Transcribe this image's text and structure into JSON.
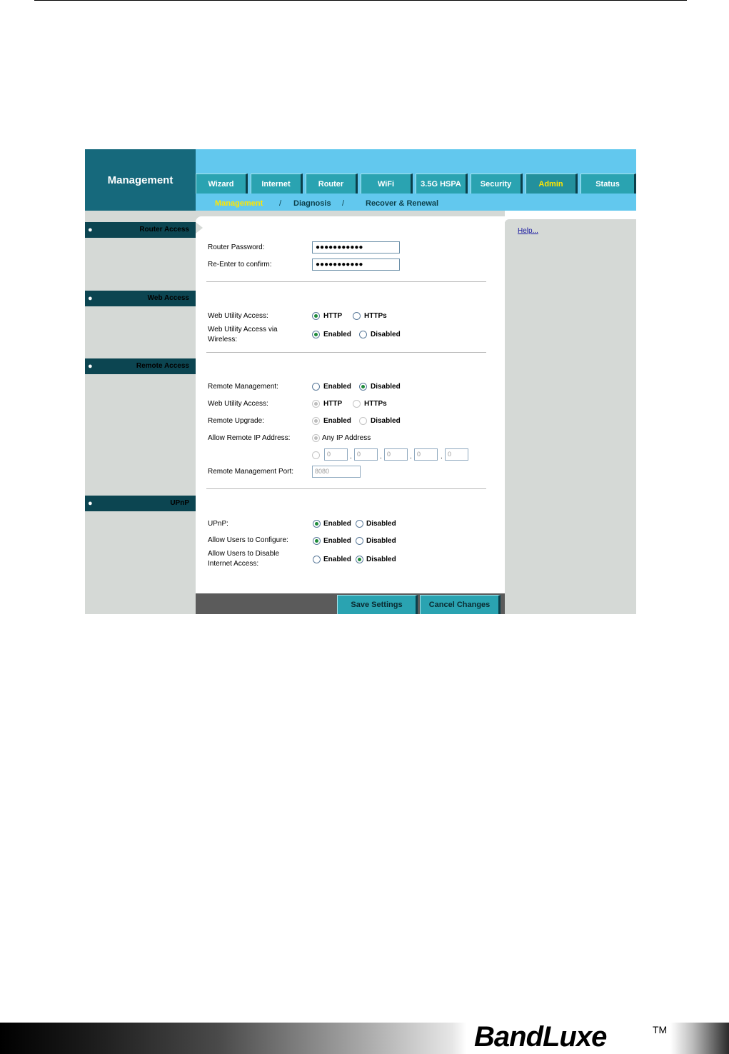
{
  "app": {
    "title": "Management"
  },
  "tabs": [
    {
      "label": "Wizard"
    },
    {
      "label": "Internet"
    },
    {
      "label": "Router"
    },
    {
      "label": "WiFi"
    },
    {
      "label": "3.5G HSPA"
    },
    {
      "label": "Security"
    },
    {
      "label": "Admin"
    },
    {
      "label": "Status"
    }
  ],
  "subnav": {
    "items": [
      "Management",
      "Diagnosis",
      "Recover & Renewal"
    ],
    "sep1": "/",
    "sep2": "/"
  },
  "sections": {
    "router_access": "Router Access",
    "web_access": "Web Access",
    "remote_access": "Remote Access",
    "upnp": "UPnP"
  },
  "help": {
    "link": "Help..."
  },
  "router_access": {
    "password_label": "Router Password:",
    "password_value": "●●●●●●●●●●●",
    "confirm_label": "Re-Enter to confirm:",
    "confirm_value": "●●●●●●●●●●●"
  },
  "web_access": {
    "access_label": "Web Utility Access:",
    "http": "HTTP",
    "https": "HTTPs",
    "wireless_label_1": "Web Utility Access via",
    "wireless_label_2": "Wireless:",
    "enabled": "Enabled",
    "disabled": "Disabled"
  },
  "remote_access": {
    "mgmt_label": "Remote Management:",
    "access_label": "Web Utility Access:",
    "upgrade_label": "Remote Upgrade:",
    "allow_ip_label": "Allow Remote IP Address:",
    "any_ip": "Any IP Address",
    "ip": [
      "0",
      "0",
      "0",
      "0",
      "0"
    ],
    "port_label": "Remote Management Port:",
    "port_value": "8080",
    "enabled": "Enabled",
    "disabled": "Disabled",
    "http": "HTTP",
    "https": "HTTPs"
  },
  "upnp": {
    "upnp_label": "UPnP:",
    "configure_label": "Allow Users to Configure:",
    "disable_label_1": "Allow Users to Disable",
    "disable_label_2": "Internet Access:",
    "enabled": "Enabled",
    "disabled": "Disabled"
  },
  "footer": {
    "save": "Save Settings",
    "cancel": "Cancel Changes"
  },
  "brand": {
    "name": "BandLuxe",
    "tm": "TM"
  }
}
